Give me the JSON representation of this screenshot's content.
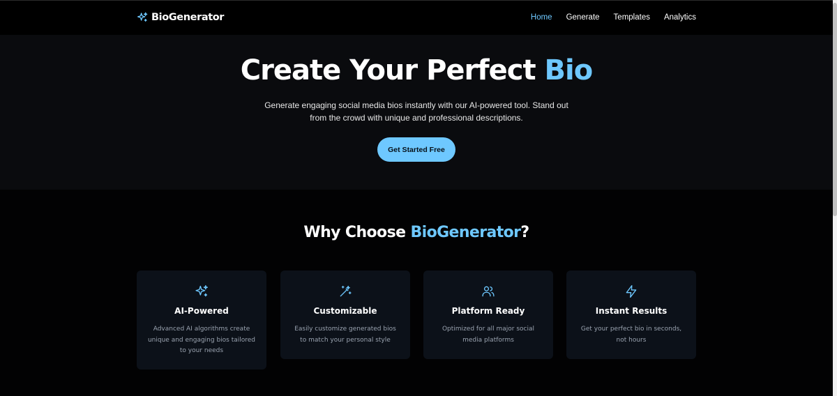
{
  "brand": {
    "name": "BioGenerator",
    "icon": "sparkles-icon"
  },
  "nav": {
    "items": [
      {
        "label": "Home",
        "active": true
      },
      {
        "label": "Generate",
        "active": false
      },
      {
        "label": "Templates",
        "active": false
      },
      {
        "label": "Analytics",
        "active": false
      }
    ]
  },
  "hero": {
    "title_main": "Create Your Perfect ",
    "title_accent": "Bio",
    "subtitle": "Generate engaging social media bios instantly with our AI-powered tool. Stand out from the crowd with unique and professional descriptions.",
    "cta_label": "Get Started Free"
  },
  "features": {
    "title_prefix": "Why Choose ",
    "title_accent": "BioGenerator",
    "title_suffix": "?",
    "cards": [
      {
        "icon": "sparkles-icon",
        "title": "AI-Powered",
        "desc": "Advanced AI algorithms create unique and engaging bios tailored to your needs"
      },
      {
        "icon": "magic-wand-icon",
        "title": "Customizable",
        "desc": "Easily customize generated bios to match your personal style"
      },
      {
        "icon": "users-icon",
        "title": "Platform Ready",
        "desc": "Optimized for all major social media platforms"
      },
      {
        "icon": "lightning-icon",
        "title": "Instant Results",
        "desc": "Get your perfect bio in seconds, not hours"
      }
    ]
  },
  "colors": {
    "accent": "#6ec8ff",
    "background": "#020203",
    "card": "#0c1119"
  }
}
